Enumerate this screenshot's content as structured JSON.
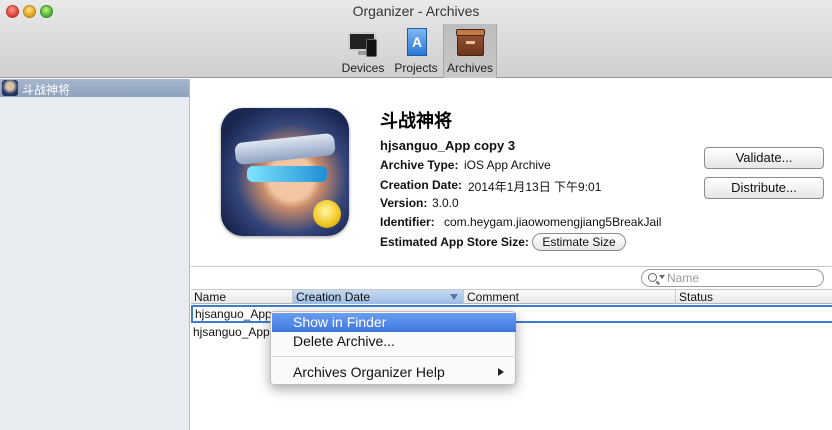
{
  "window": {
    "title": "Organizer - Archives"
  },
  "toolbar": {
    "items": [
      {
        "label": "Devices",
        "icon": "devices-icon"
      },
      {
        "label": "Projects",
        "icon": "projects-icon"
      },
      {
        "label": "Archives",
        "icon": "archives-icon",
        "selected": true
      }
    ]
  },
  "sidebar": {
    "items": [
      {
        "label": "斗战神将",
        "selected": true
      }
    ]
  },
  "details": {
    "app_name": "斗战神将",
    "archive_name": "hjsanguo_App copy 3",
    "rows": [
      {
        "key": "Archive Type:",
        "value": "iOS App Archive"
      },
      {
        "key": "Creation Date:",
        "value": "2014年1月13日 下午9:01"
      },
      {
        "key": "Version:",
        "value": "3.0.0"
      },
      {
        "key": "Identifier:",
        "value": "com.heygam.jiaowomengjiang5BreakJail"
      },
      {
        "key": "Estimated App Store Size:",
        "value": ""
      }
    ],
    "estimate_button": "Estimate Size",
    "validate_button": "Validate...",
    "distribute_button": "Distribute..."
  },
  "search": {
    "placeholder": "Name"
  },
  "table": {
    "columns": [
      "Name",
      "Creation Date",
      "Comment",
      "Status"
    ],
    "sorted_column": "Creation Date",
    "rows": [
      {
        "name": "hjsanguo_App",
        "selected": true
      },
      {
        "name": "hjsanguo_App"
      }
    ]
  },
  "context_menu": {
    "items": [
      "Show in Finder",
      "Delete Archive...",
      "Archives Organizer Help"
    ],
    "highlighted": "Show in Finder"
  },
  "colors": {
    "selection_blue": "#3d76e0",
    "sidebar_selected": "#8ea2bd"
  }
}
